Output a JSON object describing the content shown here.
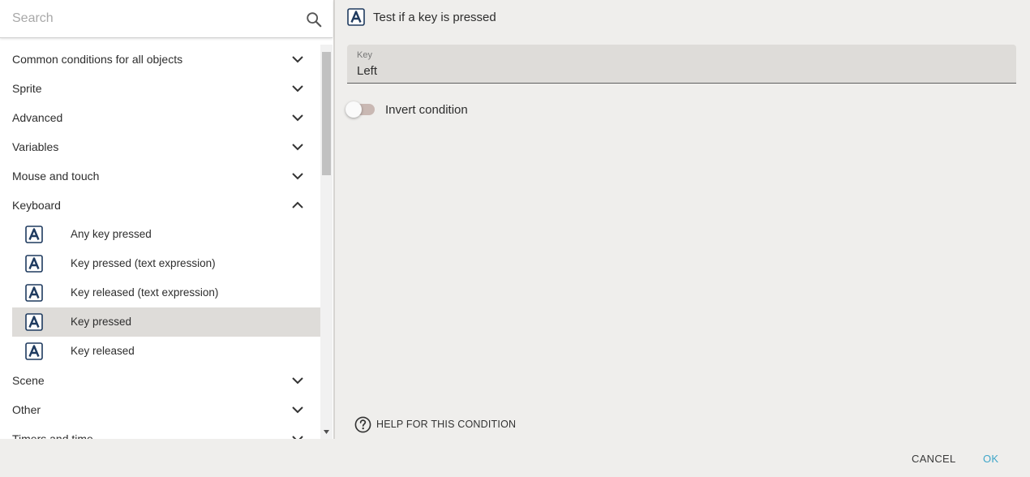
{
  "search": {
    "placeholder": "Search"
  },
  "categories_top": [
    {
      "label": "Common conditions for all objects",
      "icon": "chevron-down-icon"
    },
    {
      "label": "Sprite",
      "icon": "chevron-down-icon"
    },
    {
      "label": "Advanced",
      "icon": "chevron-down-icon"
    },
    {
      "label": "Variables",
      "icon": "chevron-down-icon"
    },
    {
      "label": "Mouse and touch",
      "icon": "chevron-down-icon"
    }
  ],
  "keyboard": {
    "label": "Keyboard",
    "icon": "chevron-up-icon",
    "expanded": true,
    "items": [
      {
        "label": "Any key pressed",
        "icon": "keyboard-a-icon",
        "selected": false
      },
      {
        "label": "Key pressed (text expression)",
        "icon": "keyboard-a-icon",
        "selected": false
      },
      {
        "label": "Key released (text expression)",
        "icon": "keyboard-a-icon",
        "selected": false
      },
      {
        "label": "Key pressed",
        "icon": "keyboard-a-icon",
        "selected": true
      },
      {
        "label": "Key released",
        "icon": "keyboard-a-icon",
        "selected": false
      }
    ]
  },
  "categories_bottom": [
    {
      "label": "Scene",
      "icon": "chevron-down-icon"
    },
    {
      "label": "Other",
      "icon": "chevron-down-icon"
    },
    {
      "label": "Timers and time",
      "icon": "chevron-down-icon"
    }
  ],
  "condition": {
    "title": "Test if a key is pressed",
    "icon": "keyboard-a-icon",
    "key_field": {
      "label": "Key",
      "value": "Left"
    },
    "invert": {
      "label": "Invert condition",
      "checked": false
    },
    "help_label": "HELP FOR THIS CONDITION"
  },
  "footer": {
    "cancel_label": "CANCEL",
    "ok_label": "OK"
  },
  "colors": {
    "accent": "#3fa6c9",
    "selected_row": "#dedcd9",
    "panel_bg": "#efeeec",
    "icon_navy": "#1e3a5f"
  }
}
